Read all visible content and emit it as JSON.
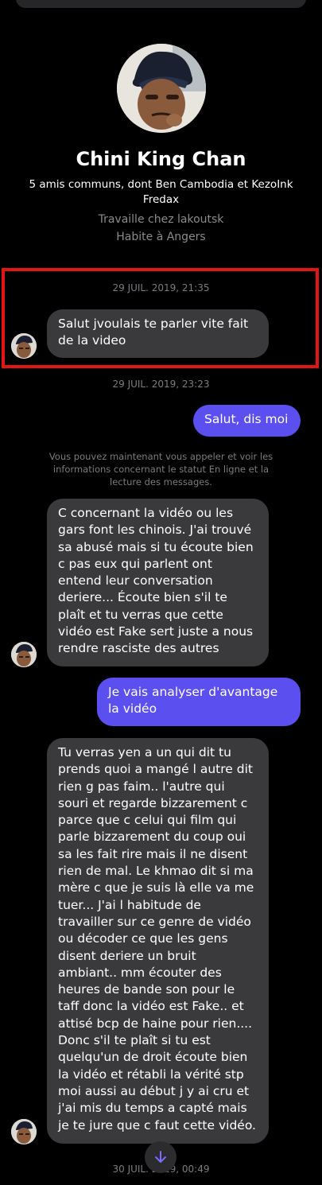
{
  "profile": {
    "name": "Chini King Chan",
    "mutual_friends": "5 amis communs, dont Ben Cambodia et KezoInk Fredax",
    "work": "Travaille chez lakoutsk",
    "city": "Habite à Angers"
  },
  "thread": {
    "timestamp_1": "29 JUIL. 2019, 21:35",
    "msg_1": "Salut jvoulais te parler vite fait de la video",
    "timestamp_2": "29 JUIL. 2019, 23:23",
    "msg_2": "Salut, dis moi",
    "info_note": "Vous pouvez maintenant vous appeler et voir les informations concernant le statut En ligne et la lecture des messages.",
    "msg_3": "C concernant la vidéo ou les gars font les chinois. J'ai trouvé sa abusé mais si tu écoute bien c pas eux qui parlent ont entend leur conversation deriere... Écoute bien s'il te plaît et tu verras que cette vidéo est Fake sert juste a nous rendre rasciste des autres",
    "msg_4": "Je vais analyser d'avantage la vidéo",
    "msg_5": "Tu verras yen a un qui dit tu prends quoi a mangé l autre dit rien g pas faim.. l'autre qui souri et regarde bizzarement c parce que c celui qui film qui parle bizzarement du coup oui sa les fait rire mais il ne disent rien de mal. Le khmao dit si ma mère c que je suis là elle va me tuer... J'ai l habitude de travailler sur ce genre de vidéo ou décoder ce que les gens disent deriere un bruit ambiant.. mm écouter des heures de bande son pour le taff donc la vidéo est Fake.. et attisé bcp de haine pour rien.... Donc s'il te plaît si tu est quelqu'un de droit écoute bien la vidéo et rétabli la vérité stp moi aussi au début j y ai cru et j'ai mis du temps a capté mais je te jure que c faut cette vidéo.",
    "timestamp_3": "30 JUIL. 2019, 00:49"
  },
  "colors": {
    "background": "#000000",
    "incoming_bubble": "#3a3a3c",
    "outgoing_bubble": "#5b4ff0",
    "highlight": "#e21515",
    "muted_text": "#8a8a8e"
  },
  "icons": {
    "scroll_down": "arrow-down-icon"
  }
}
